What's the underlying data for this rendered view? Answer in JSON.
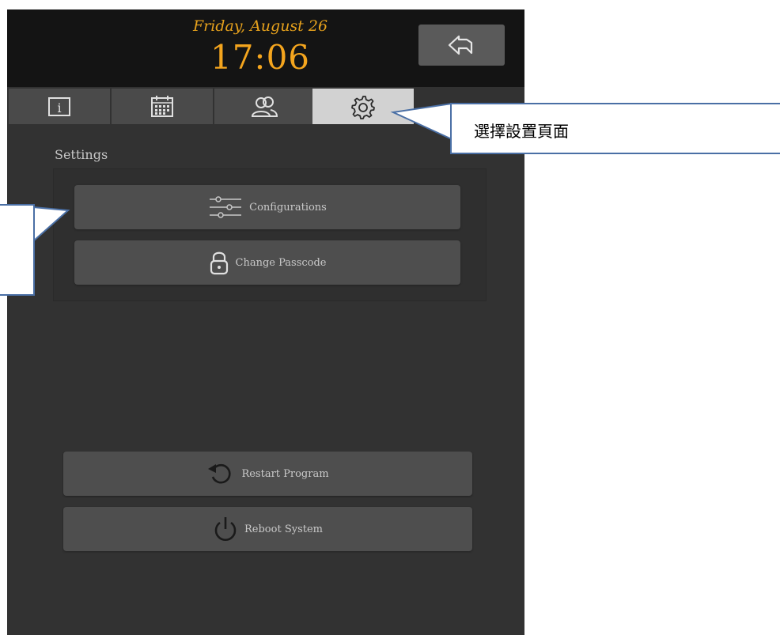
{
  "header": {
    "date": "Friday, August 26",
    "time": "17:06"
  },
  "icons": {
    "back": "back-arrow-icon",
    "info": "info-icon",
    "calendar": "calendar-icon",
    "users": "users-icon",
    "settings": "gear-icon",
    "configurations": "sliders-icon",
    "passcode": "lock-icon",
    "restart": "restart-icon",
    "reboot": "power-icon"
  },
  "tabs": [
    {
      "name": "info",
      "active": false
    },
    {
      "name": "calendar",
      "active": false
    },
    {
      "name": "users",
      "active": false
    },
    {
      "name": "settings",
      "active": true
    }
  ],
  "settings": {
    "section_label": "Settings",
    "configurations_label": "Configurations",
    "change_passcode_label": "Change Passcode",
    "restart_label": "Restart Program",
    "reboot_label": "Reboot System"
  },
  "annotation": {
    "callout_text": "選擇設置頁面"
  },
  "colors": {
    "accent": "#f4a51e",
    "panel_bg": "#323232",
    "button_bg": "#4e4e4e",
    "active_tab": "#d2d2d2",
    "callout_border": "#4a6fa5"
  }
}
